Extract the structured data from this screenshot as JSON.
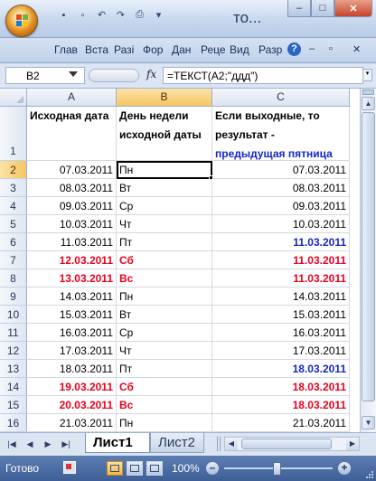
{
  "window": {
    "title": "то...",
    "minimize_glyph": "–",
    "maximize_glyph": "□",
    "close_glyph": "✕"
  },
  "quick_access": [
    {
      "icon": "save-icon",
      "glyph": "▪"
    },
    {
      "icon": "properties-icon",
      "glyph": "▫"
    },
    {
      "icon": "undo-icon",
      "glyph": "↶"
    },
    {
      "icon": "redo-icon",
      "glyph": "↷"
    },
    {
      "icon": "print-icon",
      "glyph": "⎙"
    },
    {
      "icon": "customize-icon",
      "glyph": "▾"
    }
  ],
  "ribbon_tabs": [
    "Глав",
    "Вста",
    "Разі",
    "Фор",
    "Дан",
    "Реце",
    "Вид",
    "Разр"
  ],
  "ribbon_help": "?",
  "ribbon_window": {
    "minimize": "–",
    "restore": "▫",
    "close": "✕"
  },
  "formula_bar": {
    "name_box": "B2",
    "fx_label": "fx",
    "formula": "=ТЕКСТ(A2;\"ддд\")"
  },
  "columns": [
    "A",
    "B",
    "C"
  ],
  "selected_column": "B",
  "header_row": {
    "row_number": "1",
    "A": "Исходная дата",
    "B": "День недели исходной даты",
    "C_main": "Если выходные, то результат -",
    "C_highlight": "предыдущая пятница"
  },
  "rows": [
    {
      "n": "2",
      "a": "07.03.2011",
      "b": "Пн",
      "c": "07.03.2011",
      "style": "normal"
    },
    {
      "n": "3",
      "a": "08.03.2011",
      "b": "Вт",
      "c": "08.03.2011",
      "style": "normal"
    },
    {
      "n": "4",
      "a": "09.03.2011",
      "b": "Ср",
      "c": "09.03.2011",
      "style": "normal"
    },
    {
      "n": "5",
      "a": "10.03.2011",
      "b": "Чт",
      "c": "10.03.2011",
      "style": "normal"
    },
    {
      "n": "6",
      "a": "11.03.2011",
      "b": "Пт",
      "c": "11.03.2011",
      "style": "friday"
    },
    {
      "n": "7",
      "a": "12.03.2011",
      "b": "Сб",
      "c": "11.03.2011",
      "style": "weekend"
    },
    {
      "n": "8",
      "a": "13.03.2011",
      "b": "Вс",
      "c": "11.03.2011",
      "style": "weekend"
    },
    {
      "n": "9",
      "a": "14.03.2011",
      "b": "Пн",
      "c": "14.03.2011",
      "style": "normal"
    },
    {
      "n": "10",
      "a": "15.03.2011",
      "b": "Вт",
      "c": "15.03.2011",
      "style": "normal"
    },
    {
      "n": "11",
      "a": "16.03.2011",
      "b": "Ср",
      "c": "16.03.2011",
      "style": "normal"
    },
    {
      "n": "12",
      "a": "17.03.2011",
      "b": "Чт",
      "c": "17.03.2011",
      "style": "normal"
    },
    {
      "n": "13",
      "a": "18.03.2011",
      "b": "Пт",
      "c": "18.03.2011",
      "style": "friday"
    },
    {
      "n": "14",
      "a": "19.03.2011",
      "b": "Сб",
      "c": "18.03.2011",
      "style": "weekend"
    },
    {
      "n": "15",
      "a": "20.03.2011",
      "b": "Вс",
      "c": "18.03.2011",
      "style": "weekend"
    },
    {
      "n": "16",
      "a": "21.03.2011",
      "b": "Пн",
      "c": "21.03.2011",
      "style": "normal"
    }
  ],
  "sheet_tabs": [
    {
      "label": "Лист1",
      "active": true
    },
    {
      "label": "Лист2",
      "active": false
    }
  ],
  "status": {
    "ready": "Готово",
    "zoom": "100%",
    "zoom_minus": "–",
    "zoom_plus": "+"
  },
  "colors": {
    "weekend_text": "#e8001c",
    "friday_text": "#1426c8",
    "header_highlight": "#1426c8",
    "status_bar": "#4a6aa3"
  }
}
